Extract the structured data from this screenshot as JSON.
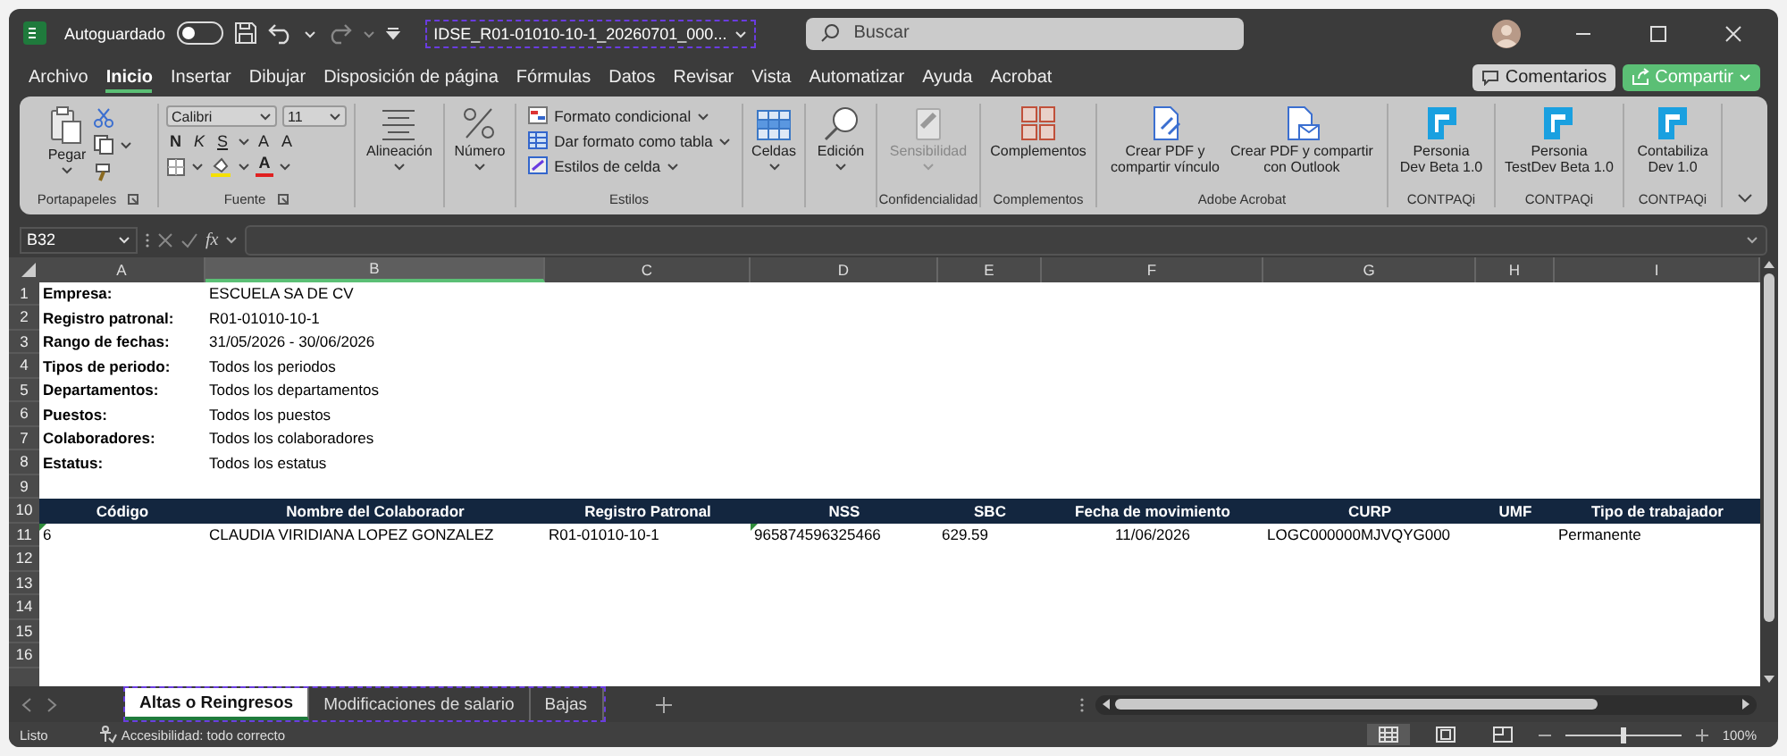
{
  "window": {
    "autosave_label": "Autoguardado",
    "autosave_on": false,
    "file_name": "IDSE_R01-01010-10-1_20260701_000...",
    "search_placeholder": "Buscar"
  },
  "menu_tabs": [
    {
      "label": "Archivo",
      "selected": false
    },
    {
      "label": "Inicio",
      "selected": true
    },
    {
      "label": "Insertar",
      "selected": false
    },
    {
      "label": "Dibujar",
      "selected": false
    },
    {
      "label": "Disposición de página",
      "selected": false
    },
    {
      "label": "Fórmulas",
      "selected": false
    },
    {
      "label": "Datos",
      "selected": false
    },
    {
      "label": "Revisar",
      "selected": false
    },
    {
      "label": "Vista",
      "selected": false
    },
    {
      "label": "Automatizar",
      "selected": false
    },
    {
      "label": "Ayuda",
      "selected": false
    },
    {
      "label": "Acrobat",
      "selected": false
    }
  ],
  "comments_button": "Comentarios",
  "share_button": "Compartir",
  "ribbon": {
    "groups": [
      {
        "kind": "clipboard",
        "label": "Portapapeles",
        "paste_label": "Pegar"
      },
      {
        "kind": "font",
        "label": "Fuente",
        "font_name": "Calibri",
        "font_size": "11",
        "style_buttons": [
          "N",
          "K",
          "S"
        ],
        "size_buttons": [
          "A",
          "A"
        ],
        "color_button": "A"
      },
      {
        "kind": "buttons",
        "buttons": [
          {
            "kind": "alignment",
            "label": "Alineación",
            "menu": true,
            "disabled": false
          }
        ]
      },
      {
        "kind": "buttons",
        "buttons": [
          {
            "kind": "number",
            "label": "Número",
            "menu": true,
            "disabled": false
          }
        ]
      },
      {
        "kind": "styles",
        "label": "Estilos",
        "items": [
          "Formato condicional",
          "Dar formato como tabla",
          "Estilos de celda"
        ]
      },
      {
        "kind": "buttons",
        "buttons": [
          {
            "kind": "cells",
            "label": "Celdas",
            "menu": true,
            "disabled": false
          }
        ]
      },
      {
        "kind": "buttons",
        "buttons": [
          {
            "kind": "editing",
            "label": "Edición",
            "menu": true,
            "disabled": false
          }
        ]
      },
      {
        "kind": "buttons",
        "label": "Confidencialidad",
        "buttons": [
          {
            "kind": "sensitivity",
            "label": "Sensibilidad",
            "menu": true,
            "disabled": true
          }
        ]
      },
      {
        "kind": "buttons",
        "label": "Complementos",
        "buttons": [
          {
            "kind": "addins",
            "label": "Complementos",
            "menu": false,
            "disabled": false
          }
        ]
      },
      {
        "kind": "buttons",
        "label": "Adobe Acrobat",
        "buttons": [
          {
            "kind": "pdf-link",
            "label": "Crear PDF y\ncompartir vínculo",
            "menu": false,
            "disabled": false
          },
          {
            "kind": "pdf-mail",
            "label": "Crear PDF y compartir\ncon Outlook",
            "menu": false,
            "disabled": false
          }
        ]
      },
      {
        "kind": "buttons",
        "label": "CONTPAQi",
        "buttons": [
          {
            "kind": "contpaqi",
            "label": "Personia\nDev Beta 1.0",
            "menu": false,
            "disabled": false
          }
        ]
      },
      {
        "kind": "buttons",
        "label": "CONTPAQi",
        "buttons": [
          {
            "kind": "contpaqi",
            "label": "Personia\nTestDev Beta 1.0",
            "menu": false,
            "disabled": false
          }
        ]
      },
      {
        "kind": "buttons",
        "label": "CONTPAQi",
        "buttons": [
          {
            "kind": "contpaqi",
            "label": "Contabiliza\nDev 1.0",
            "menu": false,
            "disabled": false
          }
        ]
      }
    ]
  },
  "formula_bar": {
    "name_box": "B32",
    "function_label": "fx"
  },
  "sheet": {
    "columns": [
      {
        "letter": "A",
        "selected": false
      },
      {
        "letter": "B",
        "selected": true
      },
      {
        "letter": "C",
        "selected": false
      },
      {
        "letter": "D",
        "selected": false
      },
      {
        "letter": "E",
        "selected": false
      },
      {
        "letter": "F",
        "selected": false
      },
      {
        "letter": "G",
        "selected": false
      },
      {
        "letter": "H",
        "selected": false
      },
      {
        "letter": "I",
        "selected": false
      }
    ],
    "row_numbers": [
      "1",
      "2",
      "3",
      "4",
      "5",
      "6",
      "7",
      "8",
      "9",
      "10",
      "11",
      "12",
      "13",
      "14",
      "15",
      "16"
    ],
    "report_info": [
      {
        "label": "Empresa:",
        "value": "ESCUELA SA DE CV"
      },
      {
        "label": "Registro patronal:",
        "value": "R01-01010-10-1"
      },
      {
        "label": "Rango de fechas:",
        "value": "31/05/2026 - 30/06/2026"
      },
      {
        "label": "Tipos de periodo:",
        "value": "Todos los periodos"
      },
      {
        "label": "Departamentos:",
        "value": "Todos los departamentos"
      },
      {
        "label": "Puestos:",
        "value": "Todos los puestos"
      },
      {
        "label": "Colaboradores:",
        "value": "Todos los colaboradores"
      },
      {
        "label": "Estatus:",
        "value": "Todos los estatus"
      }
    ],
    "table": {
      "columns": [
        "Código",
        "Nombre del Colaborador",
        "Registro Patronal",
        "NSS",
        "SBC",
        "Fecha de movimiento",
        "CURP",
        "UMF",
        "Tipo de trabajador"
      ],
      "rows": [
        [
          {
            "text": "6",
            "flagged": true
          },
          {
            "text": "CLAUDIA VIRIDIANA LOPEZ GONZALEZ",
            "flagged": false
          },
          {
            "text": "R01-01010-10-1",
            "flagged": false
          },
          {
            "text": "965874596325466",
            "flagged": true
          },
          {
            "text": "629.59",
            "flagged": false
          },
          {
            "text": "11/06/2026",
            "flagged": false
          },
          {
            "text": "LOGC000000MJVQYG000",
            "flagged": false
          },
          {
            "flagged": false
          },
          {
            "text": "Permanente",
            "flagged": false
          }
        ]
      ]
    }
  },
  "sheet_tabs": [
    {
      "label": "Altas o Reingresos",
      "selected": true
    },
    {
      "label": "Modificaciones de salario",
      "selected": false
    },
    {
      "label": "Bajas",
      "selected": false
    }
  ],
  "status_bar": {
    "status": "Listo",
    "accessibility": "Accesibilidad: todo correcto",
    "views": [
      {
        "kind": "normal",
        "selected": true
      },
      {
        "kind": "page-layout",
        "selected": false
      },
      {
        "kind": "page-break",
        "selected": false
      }
    ],
    "zoom": {
      "level": 0.5,
      "reading": "100%"
    }
  }
}
